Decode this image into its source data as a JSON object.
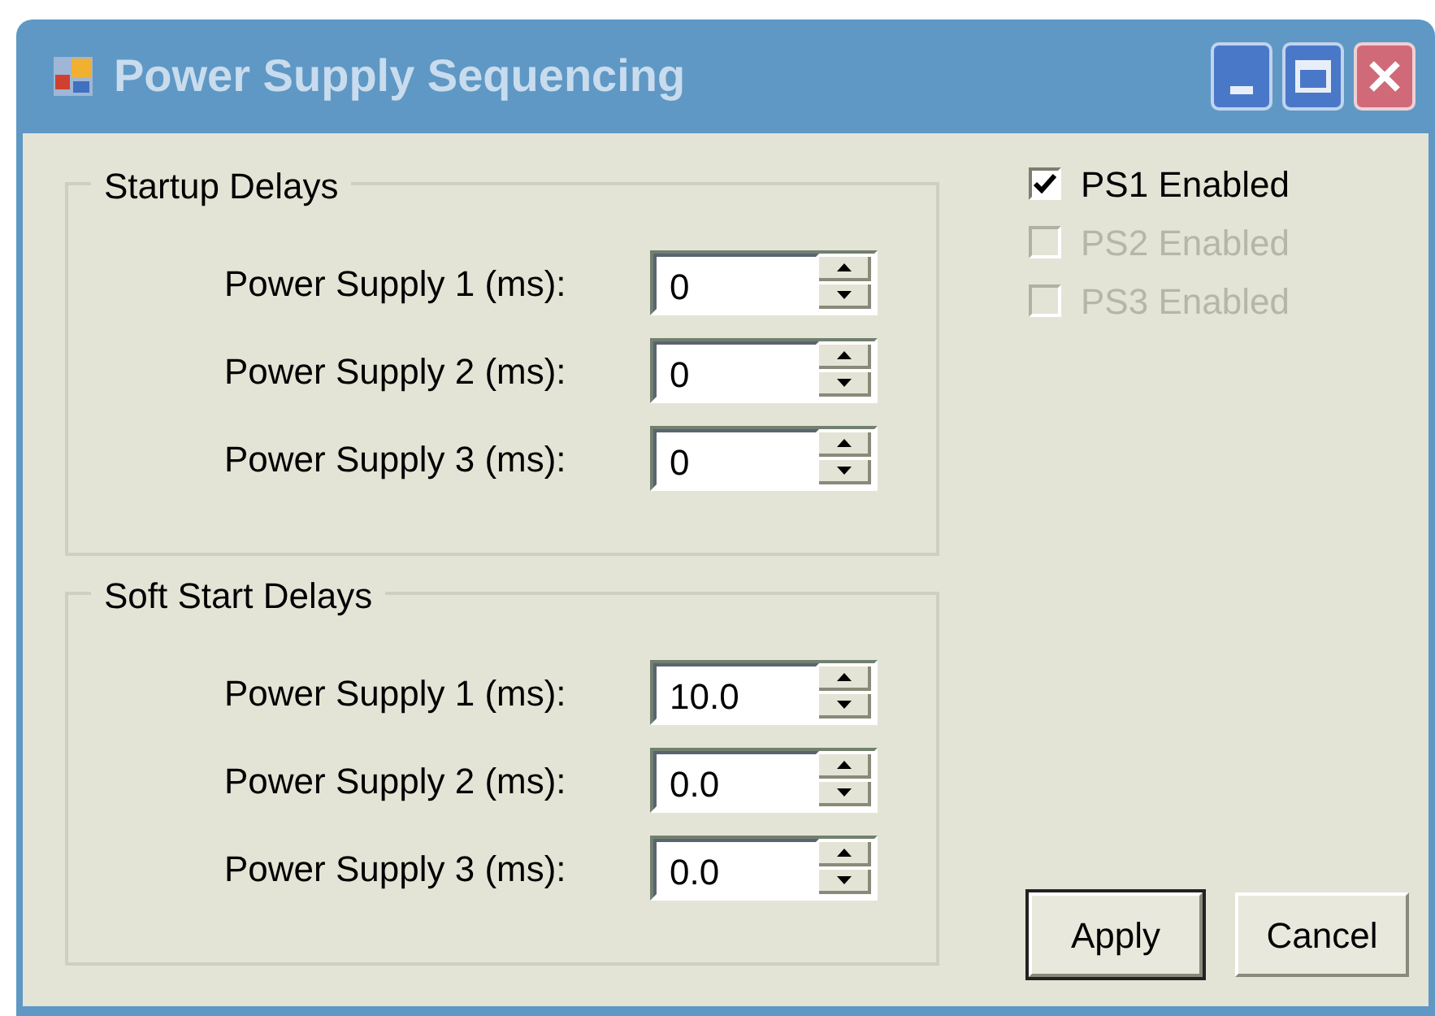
{
  "window": {
    "title": "Power Supply Sequencing"
  },
  "groups": [
    {
      "title": "Startup Delays",
      "rows": [
        {
          "label": "Power Supply 1 (ms):",
          "value": "0"
        },
        {
          "label": "Power Supply 2 (ms):",
          "value": "0"
        },
        {
          "label": "Power Supply 3 (ms):",
          "value": "0"
        }
      ]
    },
    {
      "title": "Soft Start Delays",
      "rows": [
        {
          "label": "Power Supply 1 (ms):",
          "value": "10.0"
        },
        {
          "label": "Power Supply 2 (ms):",
          "value": "0.0"
        },
        {
          "label": "Power Supply 3 (ms):",
          "value": "0.0"
        }
      ]
    }
  ],
  "checkboxes": [
    {
      "label": "PS1 Enabled",
      "checked": true,
      "disabled": false
    },
    {
      "label": "PS2 Enabled",
      "checked": false,
      "disabled": true
    },
    {
      "label": "PS3 Enabled",
      "checked": false,
      "disabled": true
    }
  ],
  "buttons": [
    {
      "label": "Apply",
      "default": true
    },
    {
      "label": "Cancel",
      "default": false
    }
  ]
}
